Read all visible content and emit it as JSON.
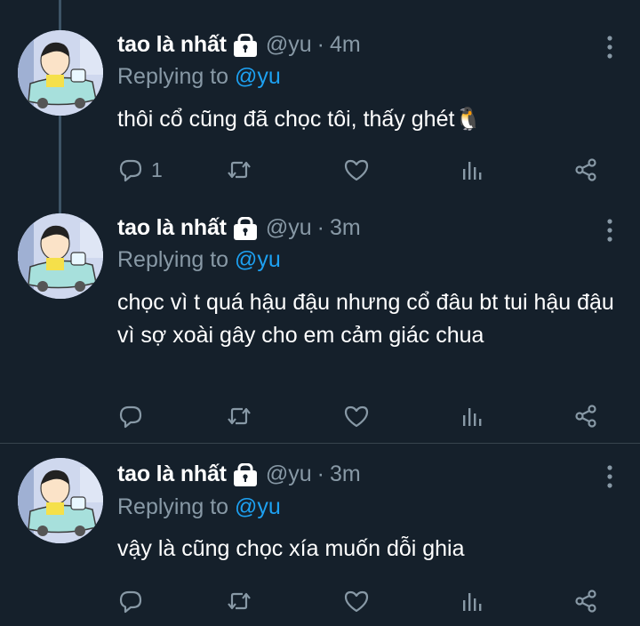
{
  "tweets": [
    {
      "name": "tao là nhất",
      "handle": "@yu",
      "dot": "·",
      "time": "4m",
      "replying_prefix": "Replying to",
      "replying_to": "@yu",
      "text": "thôi cổ cũng đã chọc tôi, thấy ghét🐧",
      "reply_count": "1"
    },
    {
      "name": "tao là nhất",
      "handle": "@yu",
      "dot": "·",
      "time": "3m",
      "replying_prefix": "Replying to",
      "replying_to": "@yu",
      "text": "chọc vì t quá hậu đậu nhưng cổ đâu bt tui hậu đậu vì sợ xoài gây cho em cảm giác chua",
      "reply_count": ""
    },
    {
      "name": "tao là nhất",
      "handle": "@yu",
      "dot": "·",
      "time": "3m",
      "replying_prefix": "Replying to",
      "replying_to": "@yu",
      "text": "vậy là cũng chọc xía muốn dỗi ghia",
      "reply_count": ""
    }
  ],
  "icons": [
    "lock-icon",
    "more-icon",
    "reply-icon",
    "retweet-icon",
    "like-icon",
    "analytics-icon",
    "share-icon"
  ],
  "colors": {
    "background": "#15202b",
    "text": "#ffffff",
    "muted": "#8899a6",
    "accent": "#1da1f2",
    "divider": "#38444d"
  }
}
